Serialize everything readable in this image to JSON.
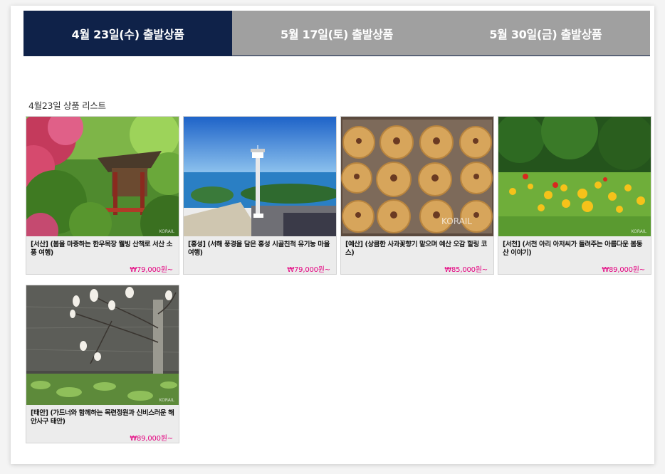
{
  "tabs": [
    {
      "label": "4월 23일(수) 출발상품",
      "active": true
    },
    {
      "label": "5월 17일(토) 출발상품",
      "active": false
    },
    {
      "label": "5월 30일(금) 출발상품",
      "active": false
    }
  ],
  "list_title": "4월23일 상품 리스트",
  "products": [
    {
      "title": "[서산] (봄을 마중하는 한우목장 웰빙 산책로 서산 소풍 여행)",
      "price": "₩79,000원~",
      "image": "pavilion-spring-flowers"
    },
    {
      "title": "[홍성] (서해 풍경을 담은 홍성 시골친척 유기농 마을 여행)",
      "price": "₩79,000원~",
      "image": "coastal-observation-tower"
    },
    {
      "title": "[예산] (상큼한 사과꽃향기 맡으며 예산 오감 힐링 코스)",
      "price": "₩85,000원~",
      "image": "apple-pies-tray"
    },
    {
      "title": "[서천] (서천 아리 아저씨가 들려주는 아름다운 봄동산 이야기)",
      "price": "₩89,000원~",
      "image": "tulip-garden"
    },
    {
      "title": "[태안] (가드너와 함께하는 목련정원과 신비스러운 해안사구 태안)",
      "price": "₩89,000원~",
      "image": "magnolia-by-pond"
    }
  ]
}
